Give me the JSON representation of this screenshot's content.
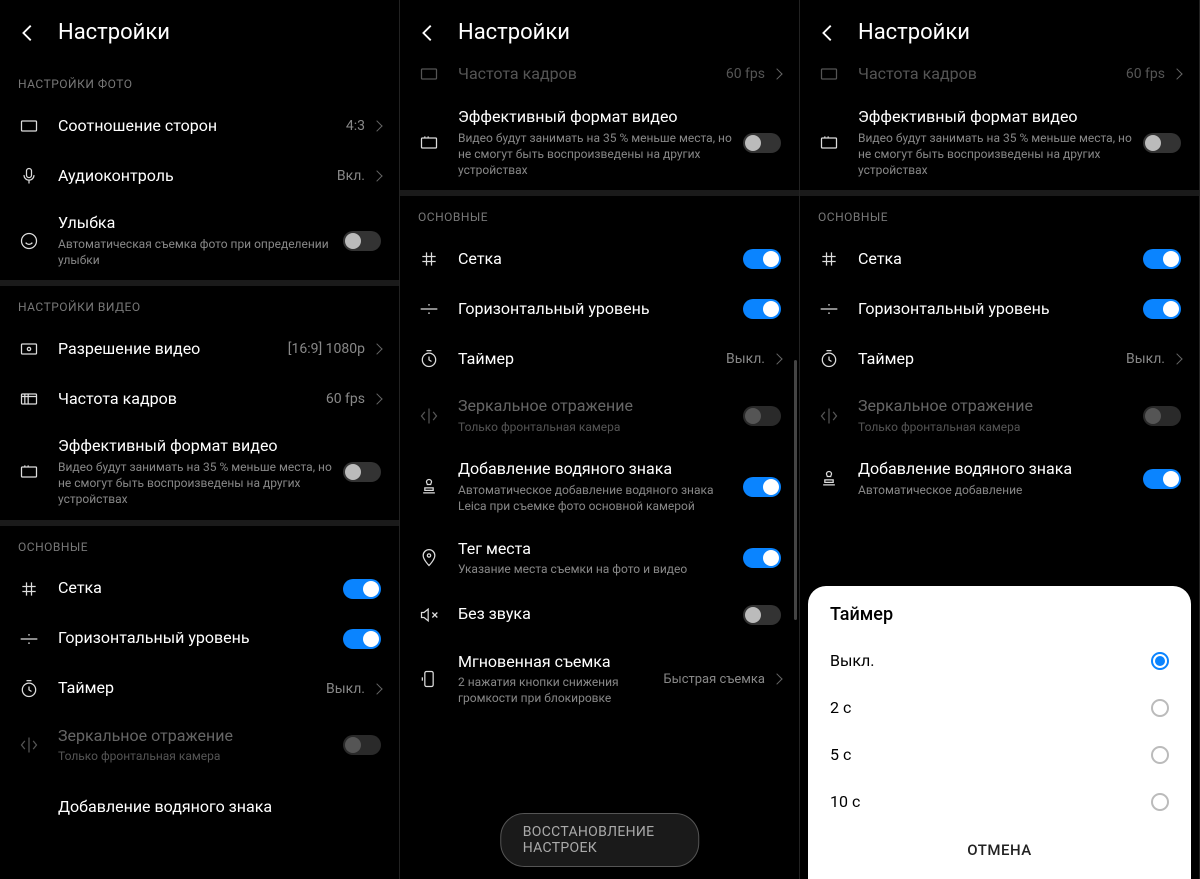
{
  "header": {
    "title": "Настройки"
  },
  "panel1": {
    "sec1": "НАСТРОЙКИ ФОТО",
    "aspect": {
      "label": "Соотношение сторон",
      "value": "4:3"
    },
    "audio": {
      "label": "Аудиоконтроль",
      "value": "Вкл."
    },
    "smile": {
      "label": "Улыбка",
      "sub": "Автоматическая съемка фото при определении улыбки"
    },
    "sec2": "НАСТРОЙКИ ВИДЕО",
    "res": {
      "label": "Разрешение видео",
      "value": "[16:9] 1080p"
    },
    "fps": {
      "label": "Частота кадров",
      "value": "60 fps"
    },
    "eff": {
      "label": "Эффективный формат видео",
      "sub": "Видео будут занимать на 35 % меньше места, но не смогут быть воспроизведены на других устройствах"
    },
    "sec3": "ОСНОВНЫЕ",
    "grid": {
      "label": "Сетка"
    },
    "level": {
      "label": "Горизонтальный уровень"
    },
    "timer": {
      "label": "Таймер",
      "value": "Выкл."
    },
    "mirror": {
      "label": "Зеркальное отражение",
      "sub": "Только фронтальная камера"
    },
    "water": {
      "label": "Добавление водяного знака"
    }
  },
  "panel2": {
    "partial": {
      "label": "Частота кадров",
      "value": "60 fps"
    },
    "eff": {
      "label": "Эффективный формат видео",
      "sub": "Видео будут занимать на 35 % меньше места, но не смогут быть воспроизведены на других устройствах"
    },
    "sec": "ОСНОВНЫЕ",
    "grid": {
      "label": "Сетка"
    },
    "level": {
      "label": "Горизонтальный уровень"
    },
    "timer": {
      "label": "Таймер",
      "value": "Выкл."
    },
    "mirror": {
      "label": "Зеркальное отражение",
      "sub": "Только фронтальная камера"
    },
    "water": {
      "label": "Добавление водяного знака",
      "sub": "Автоматическое добавление водяного знака Leica при съемке фото основной камерой"
    },
    "geo": {
      "label": "Тег места",
      "sub": "Указание места съемки на фото и видео"
    },
    "mute": {
      "label": "Без звука"
    },
    "instant": {
      "label": "Мгновенная съемка",
      "sub": "2 нажатия кнопки снижения громкости при блокировке",
      "value": "Быстрая съемка"
    },
    "restore": "ВОССТАНОВЛЕНИЕ НАСТРОЕК"
  },
  "panel3": {
    "partial": {
      "label": "Частота кадров",
      "value": "60 fps"
    },
    "eff": {
      "label": "Эффективный формат видео",
      "sub": "Видео будут занимать на 35 % меньше места, но не смогут быть воспроизведены на других устройствах"
    },
    "sec": "ОСНОВНЫЕ",
    "grid": {
      "label": "Сетка"
    },
    "level": {
      "label": "Горизонтальный уровень"
    },
    "timer": {
      "label": "Таймер",
      "value": "Выкл."
    },
    "mirror": {
      "label": "Зеркальное отражение",
      "sub": "Только фронтальная камера"
    },
    "water": {
      "label": "Добавление водяного знака",
      "sub": "Автоматическое добавление"
    },
    "modal": {
      "title": "Таймер",
      "opt1": "Выкл.",
      "opt2": "2 с",
      "opt3": "5 с",
      "opt4": "10 с",
      "cancel": "ОТМЕНА"
    }
  }
}
